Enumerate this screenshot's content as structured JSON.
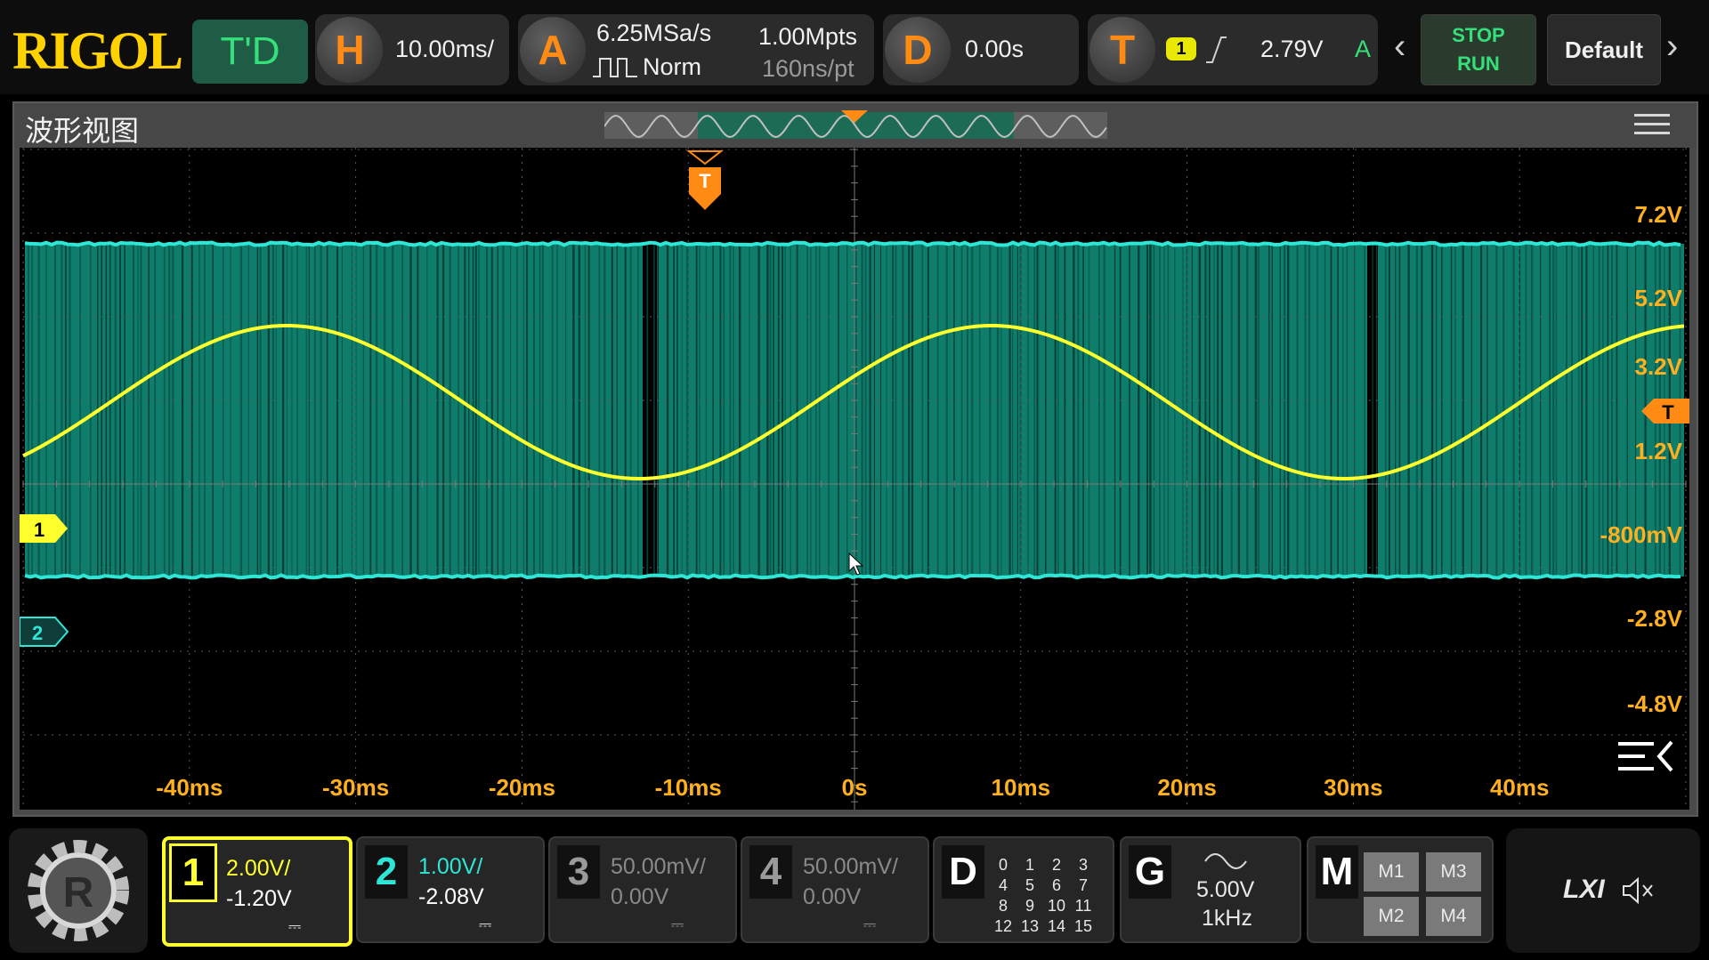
{
  "header": {
    "logo": "RIGOL",
    "mode": "T'D",
    "horizontal": {
      "label": "H",
      "scale": "10.00ms/"
    },
    "acquire": {
      "label": "A",
      "rate": "6.25MSa/s",
      "mode": "Norm",
      "depth": "1.00Mpts",
      "time_per_pt": "160ns/pt"
    },
    "delay": {
      "label": "D",
      "value": "0.00s"
    },
    "trigger": {
      "label": "T",
      "source": "1",
      "level": "2.79V",
      "sweep": "A"
    },
    "stop_label": "STOP",
    "run_label": "RUN",
    "default_label": "Default"
  },
  "waveform_view": {
    "title": "波形视图",
    "y_labels": [
      "7.2V",
      "5.2V",
      "3.2V",
      "1.2V",
      "-800mV",
      "-2.8V",
      "-4.8V"
    ],
    "x_labels": [
      "-40ms",
      "-30ms",
      "-20ms",
      "-10ms",
      "0s",
      "10ms",
      "20ms",
      "30ms",
      "40ms"
    ],
    "trigger_marker": "T",
    "ch1_marker": "1",
    "ch2_marker": "2"
  },
  "channels": [
    {
      "num": "1",
      "scale": "2.00V/",
      "offset": "-1.20V",
      "color": "#ffff2e",
      "active": true
    },
    {
      "num": "2",
      "scale": "1.00V/",
      "offset": "-2.08V",
      "color": "#2ee6d6",
      "active": false
    },
    {
      "num": "3",
      "scale": "50.00mV/",
      "offset": "0.00V",
      "color": "#8a8a8a",
      "active": false
    },
    {
      "num": "4",
      "scale": "50.00mV/",
      "offset": "0.00V",
      "color": "#8a8a8a",
      "active": false
    }
  ],
  "digital": {
    "label": "D",
    "bits": [
      "0",
      "1",
      "2",
      "3",
      "4",
      "5",
      "6",
      "7",
      "8",
      "9",
      "10",
      "11",
      "12",
      "13",
      "14",
      "15"
    ]
  },
  "generator": {
    "label": "G",
    "amplitude": "5.00V",
    "frequency": "1kHz"
  },
  "math": {
    "label": "M",
    "items": [
      "M1",
      "M3",
      "M2",
      "M4"
    ]
  },
  "status": {
    "lxi": "LXI"
  },
  "colors": {
    "ch1": "#ffff2e",
    "ch2": "#2ee6d6",
    "trigger": "#ff8a14",
    "axis_label": "#ffb01e"
  }
}
